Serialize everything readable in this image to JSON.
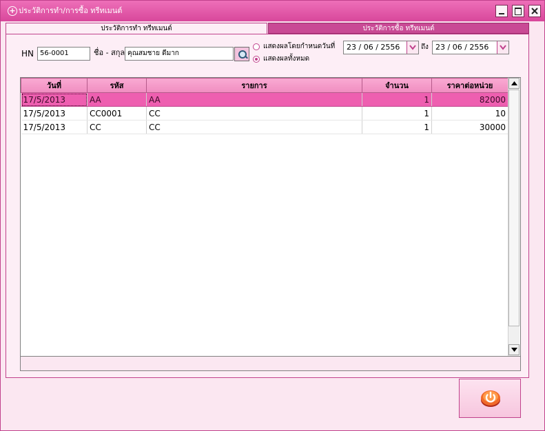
{
  "window": {
    "title": "ประวัติการทำ/การซื้อ ทรีทเมนต์"
  },
  "tabs": [
    {
      "label": "ประวัติการทำ ทรีทเมนต์",
      "active": true
    },
    {
      "label": "ประวัติการซื้อ ทรีทเมนต์",
      "active": false
    }
  ],
  "filters": {
    "hn_label": "HN",
    "hn_value": "56-0001",
    "name_label": "ชื่อ - สกุล",
    "name_value": "คุณสมชาย ดีมาก",
    "radio_by_date_label": "แสดงผลโดยกำหนดวันที่",
    "radio_all_label": "แสดงผลทั้งหมด",
    "selected_radio": "all",
    "date_from": "23 / 06 /  2556",
    "to_label": "ถึง",
    "date_to": "23 / 06 /  2556"
  },
  "table": {
    "columns": [
      "วันที่",
      "รหัส",
      "รายการ",
      "จำนวน",
      "ราคาต่อหน่วย"
    ],
    "rows": [
      {
        "date": "17/5/2013",
        "code": "AA",
        "item": "AA",
        "qty": "1",
        "price": "82000",
        "selected": true
      },
      {
        "date": "17/5/2013",
        "code": "CC0001",
        "item": "CC",
        "qty": "1",
        "price": "10",
        "selected": false
      },
      {
        "date": "17/5/2013",
        "code": "CC",
        "item": "CC",
        "qty": "1",
        "price": "30000",
        "selected": false
      }
    ]
  },
  "colors": {
    "accent": "#ee5fb0",
    "titlebar": "#d8479b",
    "background": "#fbe7f1"
  },
  "icons": {
    "title": "plus-circle-icon",
    "search": "search-icon",
    "exit": "power-icon"
  }
}
